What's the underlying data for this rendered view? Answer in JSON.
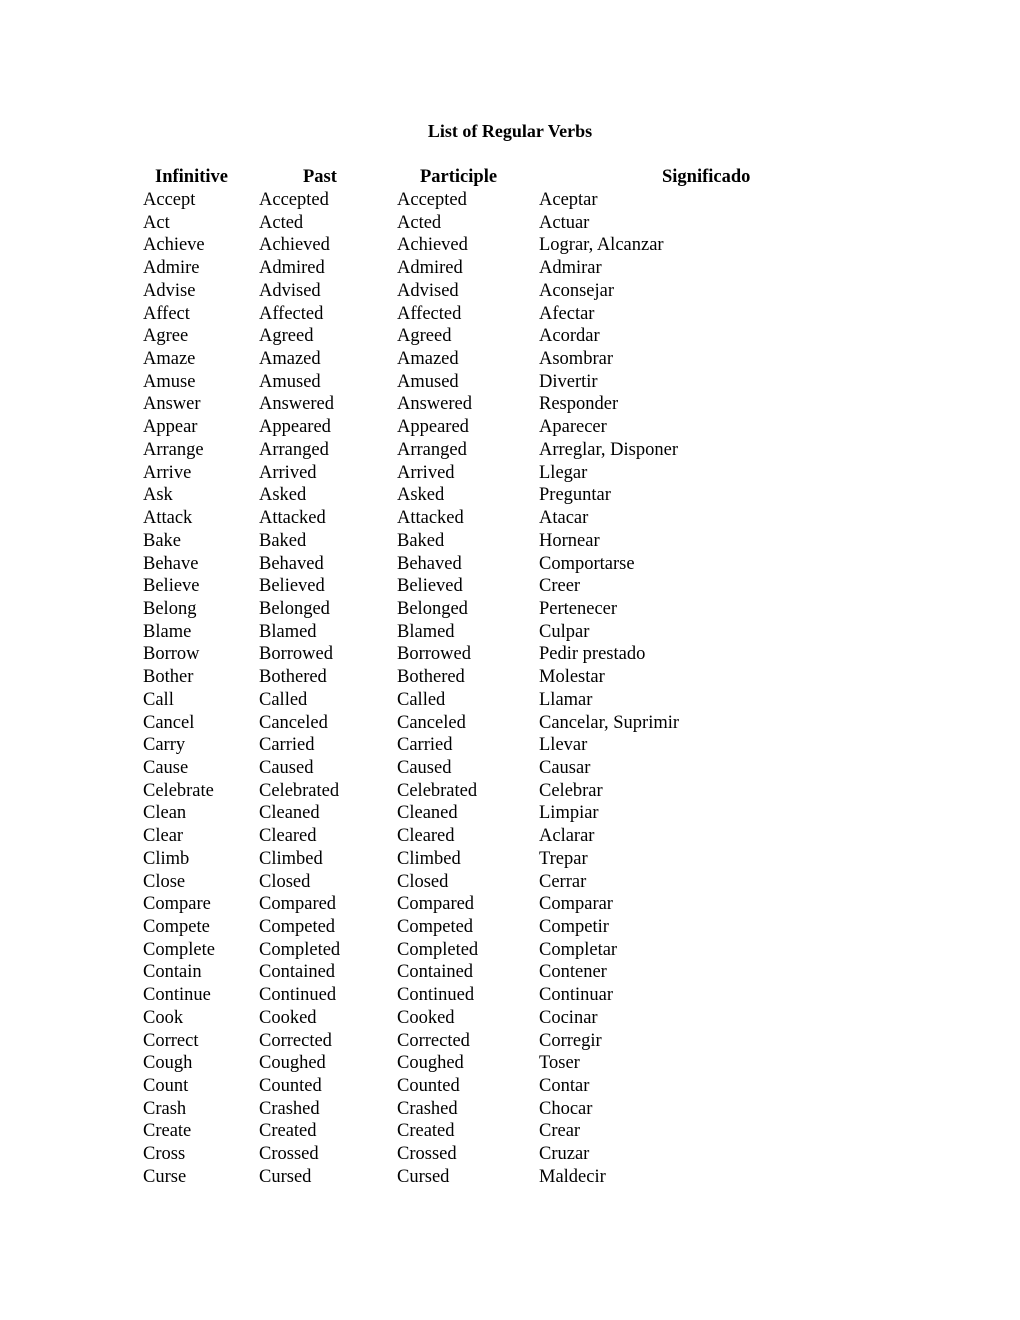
{
  "document": {
    "title": "List of Regular Verbs",
    "headers": {
      "infinitive": "Infinitive",
      "past": "Past",
      "participle": "Participle",
      "significado": "Significado"
    },
    "rows": [
      {
        "infinitive": "Accept",
        "past": "Accepted",
        "participle": "Accepted",
        "significado": "Aceptar"
      },
      {
        "infinitive": "Act",
        "past": "Acted",
        "participle": "Acted",
        "significado": "Actuar"
      },
      {
        "infinitive": "Achieve",
        "past": "Achieved",
        "participle": "Achieved",
        "significado": "Lograr, Alcanzar"
      },
      {
        "infinitive": "Admire",
        "past": "Admired",
        "participle": "Admired",
        "significado": "Admirar"
      },
      {
        "infinitive": "Advise",
        "past": "Advised",
        "participle": "Advised",
        "significado": "Aconsejar"
      },
      {
        "infinitive": "Affect",
        "past": "Affected",
        "participle": "Affected",
        "significado": "Afectar"
      },
      {
        "infinitive": "Agree",
        "past": "Agreed",
        "participle": "Agreed",
        "significado": "Acordar"
      },
      {
        "infinitive": "Amaze",
        "past": "Amazed",
        "participle": "Amazed",
        "significado": "Asombrar"
      },
      {
        "infinitive": "Amuse",
        "past": "Amused",
        "participle": "Amused",
        "significado": "Divertir"
      },
      {
        "infinitive": "Answer",
        "past": "Answered",
        "participle": "Answered",
        "significado": "Responder"
      },
      {
        "infinitive": "Appear",
        "past": "Appeared",
        "participle": "Appeared",
        "significado": "Aparecer"
      },
      {
        "infinitive": "Arrange",
        "past": "Arranged",
        "participle": "Arranged",
        "significado": "Arreglar, Disponer"
      },
      {
        "infinitive": "Arrive",
        "past": "Arrived",
        "participle": "Arrived",
        "significado": "Llegar"
      },
      {
        "infinitive": "Ask",
        "past": "Asked",
        "participle": "Asked",
        "significado": "Preguntar"
      },
      {
        "infinitive": "Attack",
        "past": "Attacked",
        "participle": "Attacked",
        "significado": "Atacar"
      },
      {
        "infinitive": "Bake",
        "past": "Baked",
        "participle": "Baked",
        "significado": "Hornear"
      },
      {
        "infinitive": "Behave",
        "past": "Behaved",
        "participle": "Behaved",
        "significado": "Comportarse"
      },
      {
        "infinitive": "Believe",
        "past": "Believed",
        "participle": "Believed",
        "significado": "Creer"
      },
      {
        "infinitive": "Belong",
        "past": "Belonged",
        "participle": "Belonged",
        "significado": "Pertenecer"
      },
      {
        "infinitive": "Blame",
        "past": "Blamed",
        "participle": "Blamed",
        "significado": "Culpar"
      },
      {
        "infinitive": "Borrow",
        "past": "Borrowed",
        "participle": "Borrowed",
        "significado": "Pedir prestado"
      },
      {
        "infinitive": "Bother",
        "past": "Bothered",
        "participle": "Bothered",
        "significado": "Molestar"
      },
      {
        "infinitive": "Call",
        "past": "Called",
        "participle": "Called",
        "significado": "Llamar"
      },
      {
        "infinitive": "Cancel",
        "past": "Canceled",
        "participle": "Canceled",
        "significado": "Cancelar, Suprimir"
      },
      {
        "infinitive": "Carry",
        "past": "Carried",
        "participle": "Carried",
        "significado": "Llevar"
      },
      {
        "infinitive": "Cause",
        "past": "Caused",
        "participle": "Caused",
        "significado": "Causar"
      },
      {
        "infinitive": "Celebrate",
        "past": "Celebrated",
        "participle": "Celebrated",
        "significado": "Celebrar"
      },
      {
        "infinitive": "Clean",
        "past": "Cleaned",
        "participle": "Cleaned",
        "significado": "Limpiar"
      },
      {
        "infinitive": "Clear",
        "past": "Cleared",
        "participle": "Cleared",
        "significado": "Aclarar"
      },
      {
        "infinitive": "Climb",
        "past": "Climbed",
        "participle": "Climbed",
        "significado": "Trepar"
      },
      {
        "infinitive": "Close",
        "past": "Closed",
        "participle": "Closed",
        "significado": "Cerrar"
      },
      {
        "infinitive": "Compare",
        "past": "Compared",
        "participle": "Compared",
        "significado": "Comparar"
      },
      {
        "infinitive": "Compete",
        "past": "Competed",
        "participle": "Competed",
        "significado": "Competir"
      },
      {
        "infinitive": "Complete",
        "past": "Completed",
        "participle": "Completed",
        "significado": "Completar"
      },
      {
        "infinitive": "Contain",
        "past": "Contained",
        "participle": "Contained",
        "significado": "Contener"
      },
      {
        "infinitive": "Continue",
        "past": "Continued",
        "participle": "Continued",
        "significado": "Continuar"
      },
      {
        "infinitive": "Cook",
        "past": "Cooked",
        "participle": "Cooked",
        "significado": "Cocinar"
      },
      {
        "infinitive": "Correct",
        "past": "Corrected",
        "participle": "Corrected",
        "significado": "Corregir"
      },
      {
        "infinitive": "Cough",
        "past": "Coughed",
        "participle": "Coughed",
        "significado": "Toser"
      },
      {
        "infinitive": "Count",
        "past": "Counted",
        "participle": "Counted",
        "significado": "Contar"
      },
      {
        "infinitive": "Crash",
        "past": "Crashed",
        "participle": "Crashed",
        "significado": "Chocar"
      },
      {
        "infinitive": "Create",
        "past": "Created",
        "participle": "Created",
        "significado": "Crear"
      },
      {
        "infinitive": "Cross",
        "past": "Crossed",
        "participle": "Crossed",
        "significado": "Cruzar"
      },
      {
        "infinitive": "Curse",
        "past": "Cursed",
        "participle": "Cursed",
        "significado": "Maldecir"
      }
    ]
  }
}
